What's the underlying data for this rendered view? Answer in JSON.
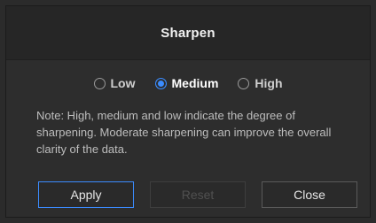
{
  "dialog": {
    "title": "Sharpen",
    "level_options": [
      {
        "label": "Low",
        "selected": false
      },
      {
        "label": "Medium",
        "selected": true
      },
      {
        "label": "High",
        "selected": false
      }
    ],
    "note": "Note: High, medium and low indicate the degree of sharpening. Moderate sharpening can improve the overall clarity of the data.",
    "buttons": {
      "apply": "Apply",
      "reset": "Reset",
      "close": "Close"
    }
  },
  "colors": {
    "accent": "#3b8cff",
    "background": "#2d2d2d",
    "titlebar": "#262626"
  }
}
